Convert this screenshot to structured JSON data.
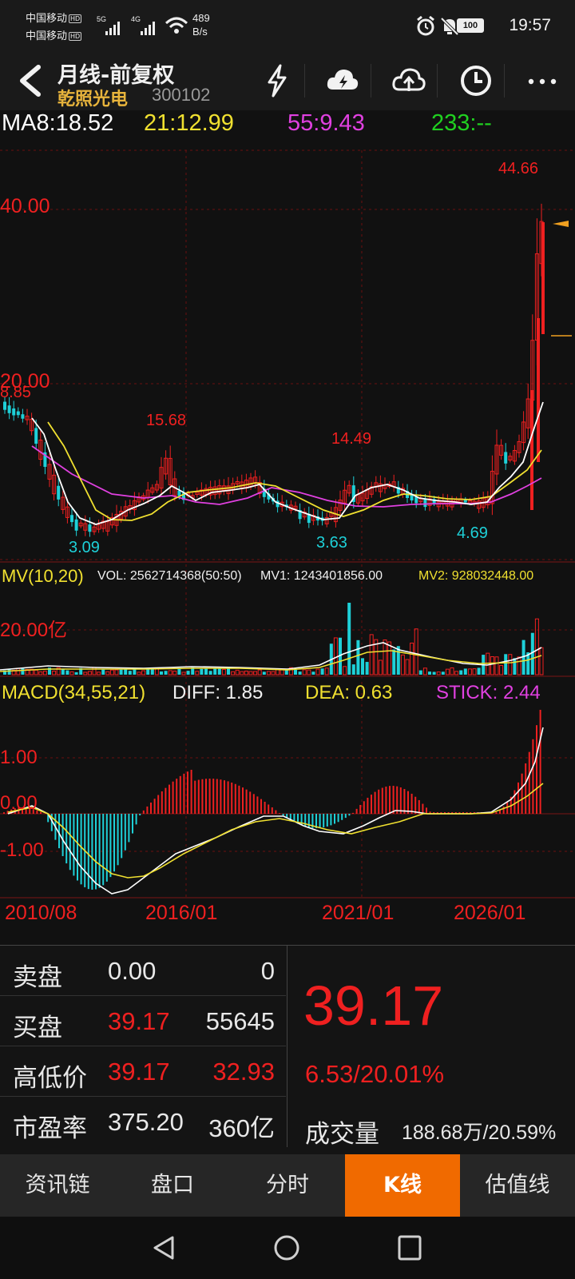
{
  "status_bar": {
    "carrier1": "中国移动",
    "carrier2": "中国移动",
    "hd": "HD",
    "net1": "5G",
    "net2": "4G",
    "speed_value": "489",
    "speed_unit": "B/s",
    "battery": "100",
    "time": "19:57"
  },
  "header": {
    "title": "月线-前复权",
    "stock_name": "乾照光电",
    "stock_code": "300102"
  },
  "ma_legend": {
    "ma8": "MA8:18.52",
    "ma21": "21:12.99",
    "ma55": "55:9.43",
    "ma233": "233:--"
  },
  "price_axis": {
    "high_tick": "40.00",
    "mid_tick": "20.00"
  },
  "price_annotations": {
    "peak": "44.66",
    "start": "8.85",
    "peak_2016": "15.68",
    "peak_2021": "14.49",
    "low_2013": "3.09",
    "low_2020": "3.63",
    "low_2024": "4.69"
  },
  "volume_legend": {
    "title": "MV(10,20)",
    "vol": "VOL: 2562714368(50:50)",
    "mv1": "MV1: 1243401856.00",
    "mv2": "MV2: 928032448.00",
    "tick": "20.00亿"
  },
  "macd_legend": {
    "title": "MACD(34,55,21)",
    "diff": "DIFF: 1.85",
    "dea": "DEA: 0.63",
    "stick": "STICK: 2.44",
    "tick_pos": "1.00",
    "tick_zero": "0.00",
    "tick_neg": "-1.00"
  },
  "date_axis": [
    "2010/08",
    "2016/01",
    "2021/01",
    "2026/01"
  ],
  "quote": {
    "rows": [
      {
        "label": "卖盘",
        "v1": "0.00",
        "v2": "0"
      },
      {
        "label": "买盘",
        "v1": "39.17",
        "v2": "55645"
      },
      {
        "label": "高低价",
        "v1": "39.17",
        "v2": "32.93"
      },
      {
        "label": "市盈率",
        "v1": "375.20",
        "v2": "360亿"
      }
    ],
    "price": "39.17",
    "change": "6.53/20.01%",
    "volume_label": "成交量",
    "volume_value": "188.68万/20.59%"
  },
  "tabs": [
    "资讯链",
    "盘口",
    "分时",
    "K线",
    "估值线"
  ],
  "colors": {
    "up": "#ef2020",
    "down": "#1ed0d8",
    "ma8": "#ffffff",
    "ma21": "#f0e030",
    "ma55": "#e040e0",
    "ma233": "#20d020",
    "accent": "#f06a00"
  }
}
